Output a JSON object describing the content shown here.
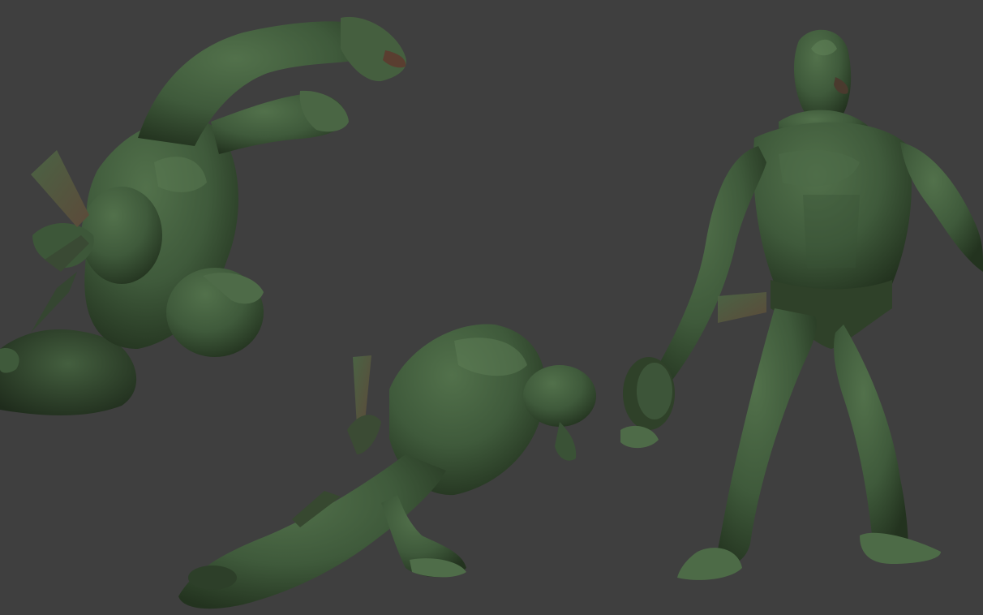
{
  "viewport": {
    "background": "#3f3f3f"
  },
  "material": {
    "base_color": "#3f5a3b",
    "highlight_color": "#52714b",
    "shadow_color": "#23331f",
    "rim_color": "#5c4a3a"
  },
  "figures": [
    {
      "name": "figure-top-view"
    },
    {
      "name": "figure-crouching"
    },
    {
      "name": "figure-standing"
    }
  ]
}
